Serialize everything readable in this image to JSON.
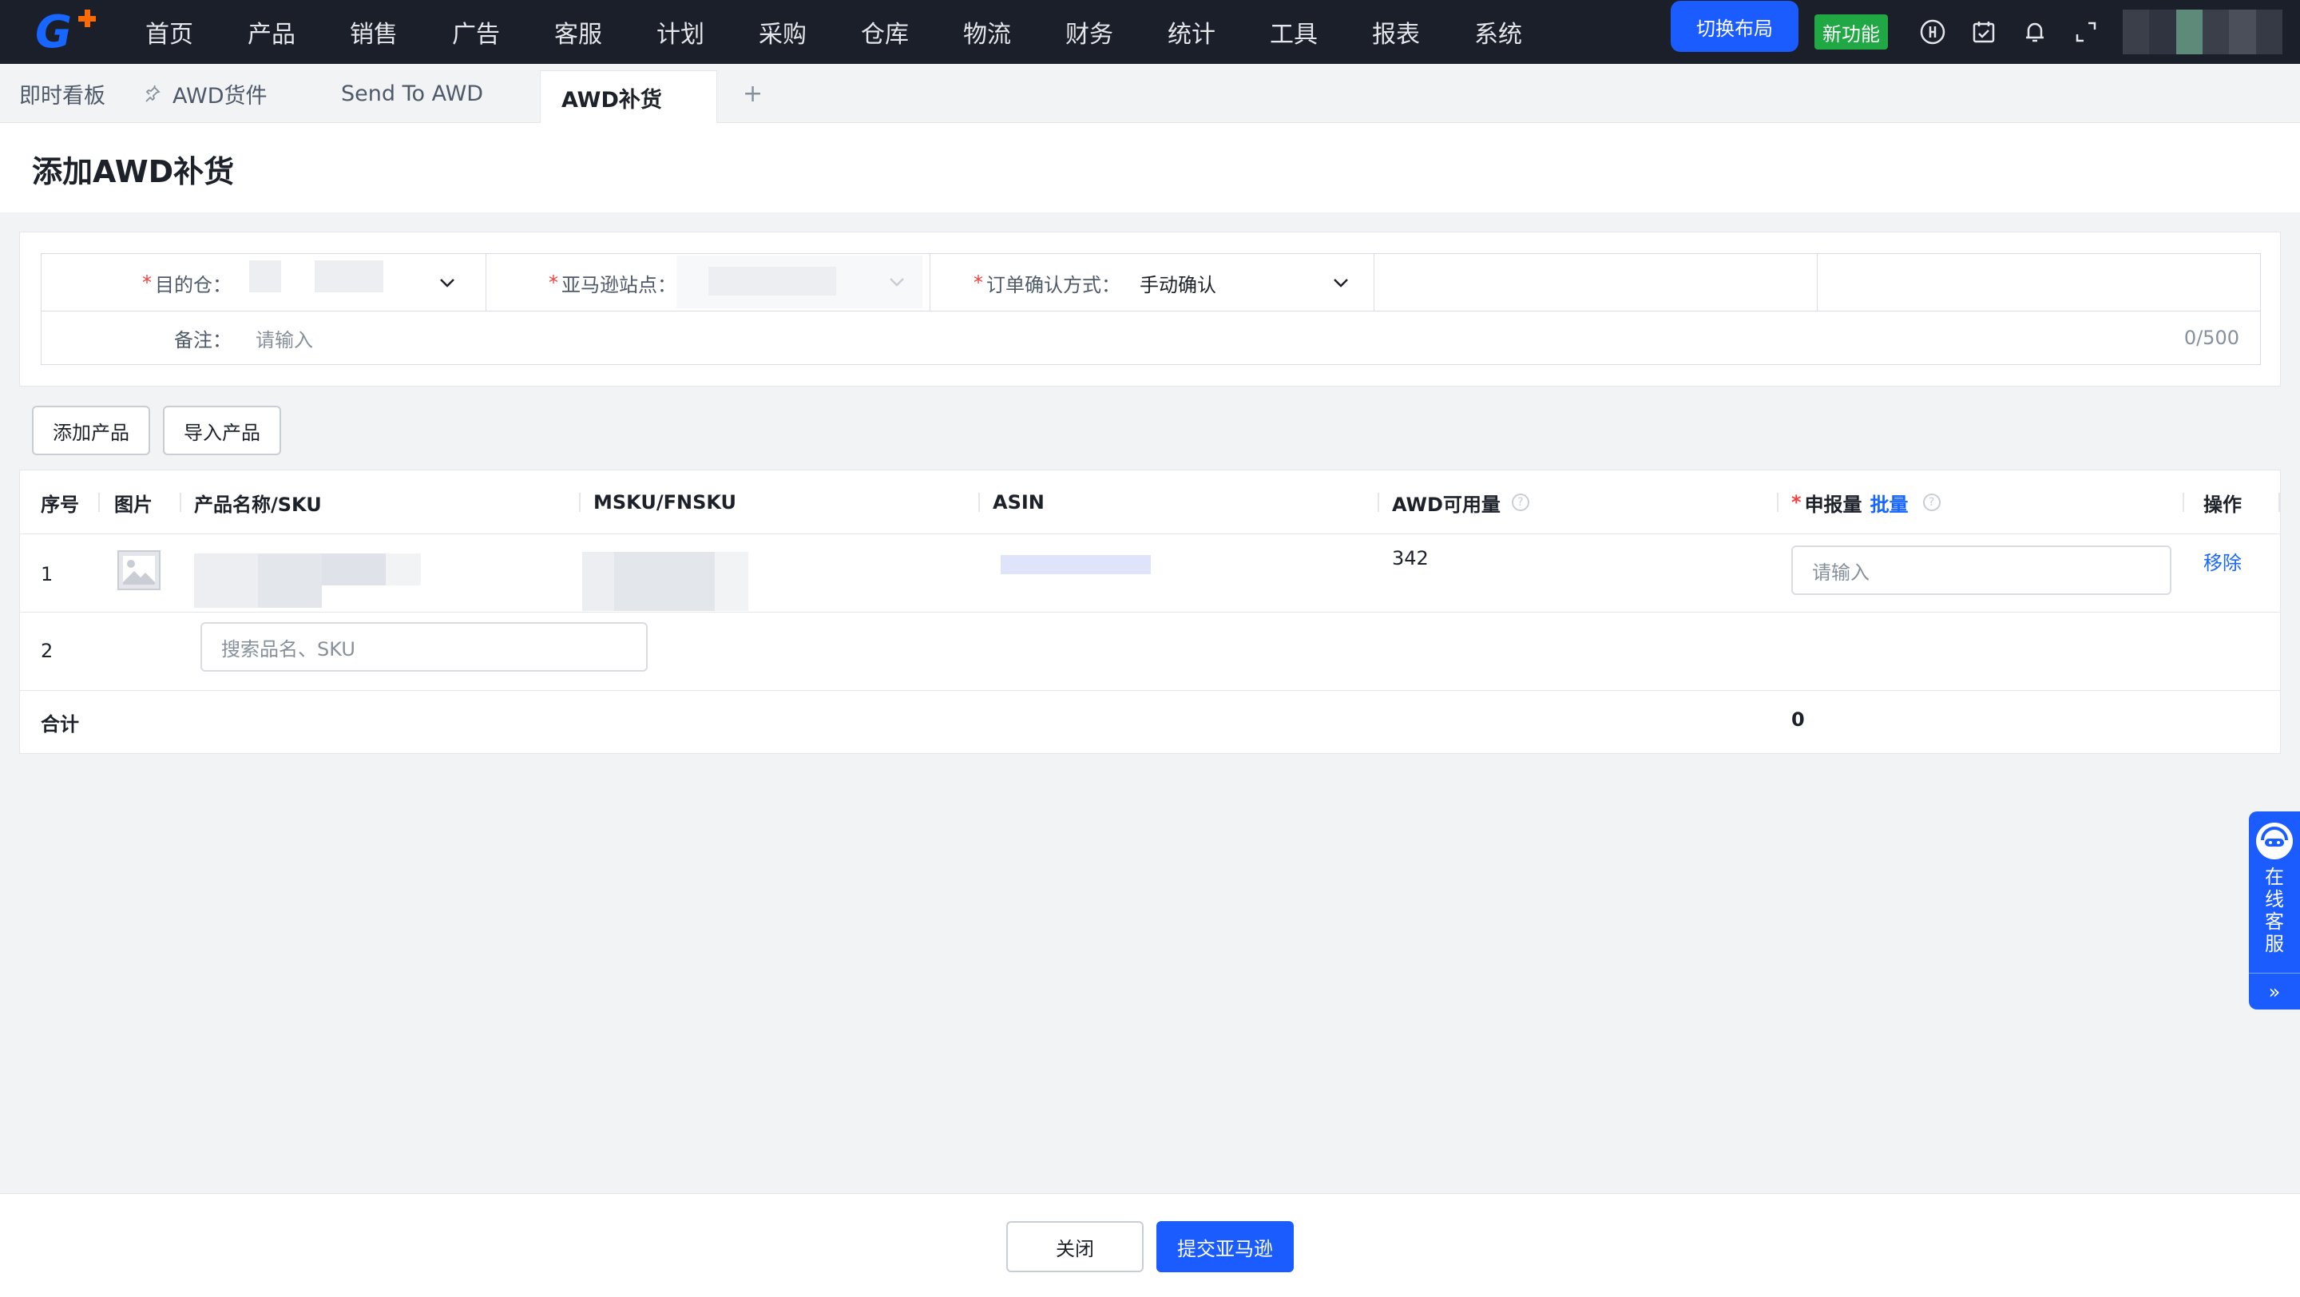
{
  "nav": {
    "menu": [
      "首页",
      "产品",
      "销售",
      "广告",
      "客服",
      "计划",
      "采购",
      "仓库",
      "物流",
      "财务",
      "统计",
      "工具",
      "报表",
      "系统"
    ],
    "switch_layout": "切换布局",
    "new_feature": "新功能"
  },
  "tabs": {
    "dashboard": "即时看板",
    "awd_shipment": "AWD货件",
    "send_to_awd": "Send To AWD",
    "awd_replenish": "AWD补货",
    "add": "+"
  },
  "page": {
    "title": "添加AWD补货"
  },
  "form": {
    "dest_label": "目的仓：",
    "site_label": "亚马逊站点：",
    "confirm_label": "订单确认方式：",
    "confirm_value": "手动确认",
    "remark_label": "备注：",
    "remark_placeholder": "请输入",
    "remark_counter": "0/500"
  },
  "actions": {
    "add_product": "添加产品",
    "import_product": "导入产品"
  },
  "table": {
    "headers": {
      "seq": "序号",
      "image": "图片",
      "name_sku": "产品名称/SKU",
      "msku_fnsku": "MSKU/FNSKU",
      "asin": "ASIN",
      "awd_available": "AWD可用量",
      "declare_qty": "申报量",
      "batch": "批量",
      "operation": "操作"
    },
    "rows": [
      {
        "seq": "1",
        "awd_available": "342",
        "qty_placeholder": "请输入",
        "remove": "移除"
      },
      {
        "seq": "2",
        "search_placeholder": "搜索品名、SKU"
      }
    ],
    "total_label": "合计",
    "total_value": "0"
  },
  "footer": {
    "close": "关闭",
    "submit": "提交亚马逊"
  },
  "cs": {
    "label": "在线客服"
  },
  "colors": {
    "primary": "#1a5cff",
    "nav_bg": "#1b1f2a",
    "required": "#f53f3f",
    "new_feature": "#20a845"
  }
}
